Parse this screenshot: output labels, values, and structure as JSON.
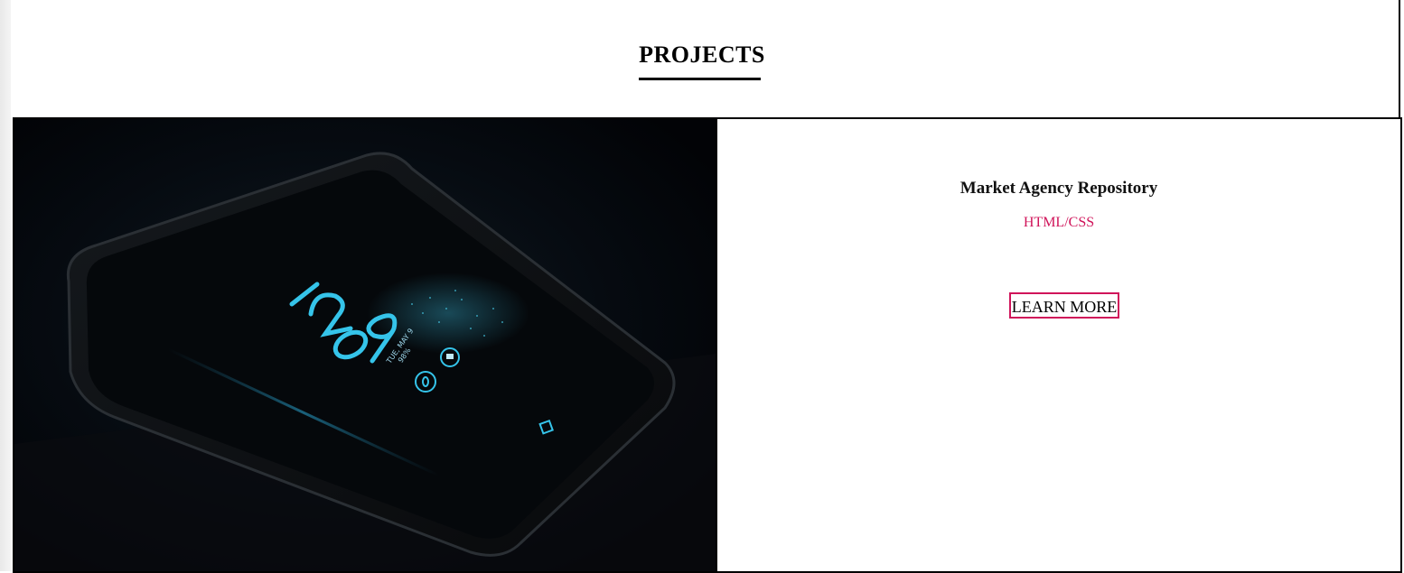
{
  "section": {
    "title": "PROJECTS"
  },
  "project": {
    "name": "Market Agency Repository",
    "tech": "HTML/CSS",
    "button_label": "LEARN MORE",
    "image_icon": "smartphone-lockscreen-photo"
  },
  "colors": {
    "accent": "#d0145a",
    "text": "#000000",
    "background": "#ffffff",
    "screen_glow": "#2fb8e0"
  }
}
